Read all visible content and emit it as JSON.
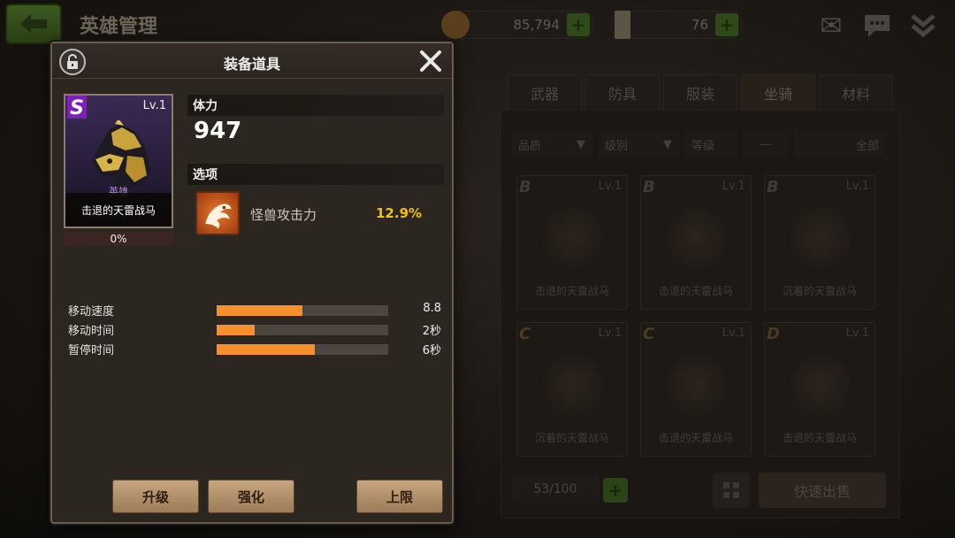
{
  "header": {
    "title": "英雄管理",
    "gold": "85,794",
    "tickets": "76"
  },
  "tabs": [
    "武器",
    "防具",
    "服装",
    "坐骑",
    "材料"
  ],
  "filters": {
    "quality": "品质",
    "level": "级别",
    "grade": "等级",
    "dash": "—",
    "all": "全部"
  },
  "inventory": {
    "items": [
      {
        "grade": "B",
        "level": "Lv.1",
        "name": "击退的天雷战马"
      },
      {
        "grade": "B",
        "level": "Lv.1",
        "name": "击退的天雷战马"
      },
      {
        "grade": "B",
        "level": "Lv.1",
        "name": "沉着的天雷战马"
      },
      {
        "grade": "C",
        "level": "Lv.1",
        "name": "沉着的天雷战马"
      },
      {
        "grade": "C",
        "level": "Lv.1",
        "name": "击退的天雷战马"
      },
      {
        "grade": "D",
        "level": "Lv.1",
        "name": "击退的天雷战马"
      }
    ],
    "count": "53/100",
    "quick_sell": "快速出售"
  },
  "modal": {
    "title": "装备道具",
    "item": {
      "grade": "S",
      "level": "Lv.1",
      "rarity": "英雄",
      "name": "击退的天雷战马",
      "progress": "0%"
    },
    "stamina_label": "体力",
    "stamina_value": "947",
    "options_label": "选项",
    "option": {
      "name": "怪兽攻击力",
      "value": "12.9%"
    },
    "stats": [
      {
        "label": "移动速度",
        "value": "8.8",
        "fill": 0.5
      },
      {
        "label": "移动时间",
        "value": "2秒",
        "fill": 0.22
      },
      {
        "label": "暂停时间",
        "value": "6秒",
        "fill": 0.57
      }
    ],
    "buttons": {
      "upgrade": "升级",
      "enhance": "强化",
      "limit": "上限"
    }
  },
  "colors": {
    "accent_orange": "#f7902a",
    "value_yellow": "#f2c200",
    "button_tan": "#c7a57e"
  }
}
